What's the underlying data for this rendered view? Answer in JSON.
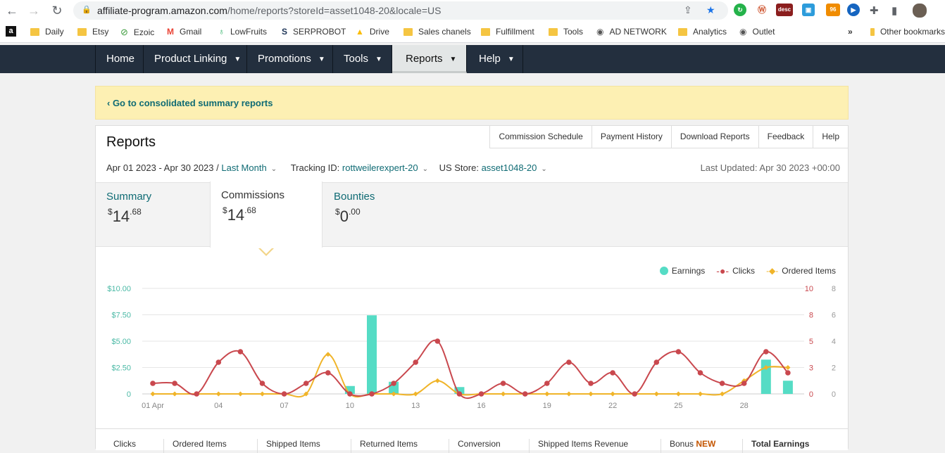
{
  "browser": {
    "url_domain": "affiliate-program.amazon.com",
    "url_path": "/home/reports?storeId=asset1048-20&locale=US",
    "ext_desc_label": "desc",
    "ext_badge_count": "96",
    "bookmarks": [
      "Daily",
      "Etsy",
      "Ezoic",
      "Gmail",
      "LowFruits",
      "SERPROBOT",
      "Drive",
      "Sales chanels",
      "Fulfillment",
      "Tools",
      "AD NETWORK",
      "Analytics",
      "Outlet"
    ],
    "overflow": "»",
    "other_bookmarks": "Other bookmarks"
  },
  "nav": {
    "tabs": [
      "Home",
      "Product Linking",
      "Promotions",
      "Tools",
      "Reports",
      "Help"
    ],
    "active": "Reports"
  },
  "banner": {
    "link": "‹ Go to consolidated summary reports"
  },
  "reports": {
    "title": "Reports",
    "header_tabs": [
      "Commission Schedule",
      "Payment History",
      "Download Reports",
      "Feedback",
      "Help"
    ],
    "date_range": "Apr 01 2023 - Apr 30 2023 /",
    "period": "Last Month",
    "tracking_label": "Tracking ID:",
    "tracking_id": "rottweilerexpert-20",
    "store_label": "US Store:",
    "store_id": "asset1048-20",
    "last_updated": "Last Updated: Apr 30 2023 +00:00",
    "summary": [
      {
        "label": "Summary",
        "cur": "$",
        "whole": "14",
        "cents": ".68"
      },
      {
        "label": "Commissions",
        "cur": "$",
        "whole": "14",
        "cents": ".68"
      },
      {
        "label": "Bounties",
        "cur": "$",
        "whole": "0",
        "cents": ".00"
      }
    ],
    "legend": [
      "Earnings",
      "Clicks",
      "Ordered Items"
    ],
    "columns": [
      "Clicks",
      "Ordered Items",
      "Shipped Items",
      "Returned Items",
      "Conversion",
      "Shipped Items Revenue",
      "Bonus",
      "Total Earnings"
    ],
    "bonus_badge": "NEW"
  },
  "chart_data": {
    "type": "bar+line",
    "x": [
      1,
      2,
      3,
      4,
      5,
      6,
      7,
      8,
      9,
      10,
      11,
      12,
      13,
      14,
      15,
      16,
      17,
      18,
      19,
      20,
      21,
      22,
      23,
      24,
      25,
      26,
      27,
      28,
      29,
      30
    ],
    "xticks": [
      "01 Apr",
      "04",
      "07",
      "10",
      "13",
      "16",
      "19",
      "22",
      "25",
      "28"
    ],
    "yticks_left": [
      "$10.00",
      "$7.50",
      "$5.00",
      "$2.50",
      "0"
    ],
    "yticks_clicks": [
      "10",
      "8",
      "5",
      "3",
      "0"
    ],
    "yticks_items": [
      "8",
      "6",
      "4",
      "2",
      "0"
    ],
    "series": [
      {
        "name": "Earnings",
        "axis": "left",
        "ylim": [
          0,
          10
        ],
        "color": "#55dcc5",
        "values": [
          0,
          0,
          0,
          0,
          0,
          0,
          0,
          0,
          0,
          0.75,
          7.45,
          1.15,
          0,
          0,
          0.65,
          0,
          0,
          0,
          0,
          0,
          0,
          0,
          0,
          0,
          0,
          0,
          0,
          0,
          3.25,
          1.25
        ]
      },
      {
        "name": "Clicks",
        "axis": "right1",
        "ylim": [
          0,
          10
        ],
        "color": "#c9484e",
        "values": [
          1,
          1,
          0,
          3,
          4,
          1,
          0,
          1,
          2,
          0,
          0,
          1,
          3,
          5,
          0,
          0,
          1,
          0,
          1,
          3,
          1,
          2,
          0,
          3,
          4,
          2,
          1,
          1,
          4,
          2
        ]
      },
      {
        "name": "Ordered Items",
        "axis": "right2",
        "ylim": [
          0,
          8
        ],
        "color": "#f0b429",
        "values": [
          0,
          0,
          0,
          0,
          0,
          0,
          0,
          0,
          3,
          0,
          0,
          0,
          0,
          1,
          0,
          0,
          0,
          0,
          0,
          0,
          0,
          0,
          0,
          0,
          0,
          0,
          0,
          1,
          2,
          2
        ]
      }
    ]
  }
}
